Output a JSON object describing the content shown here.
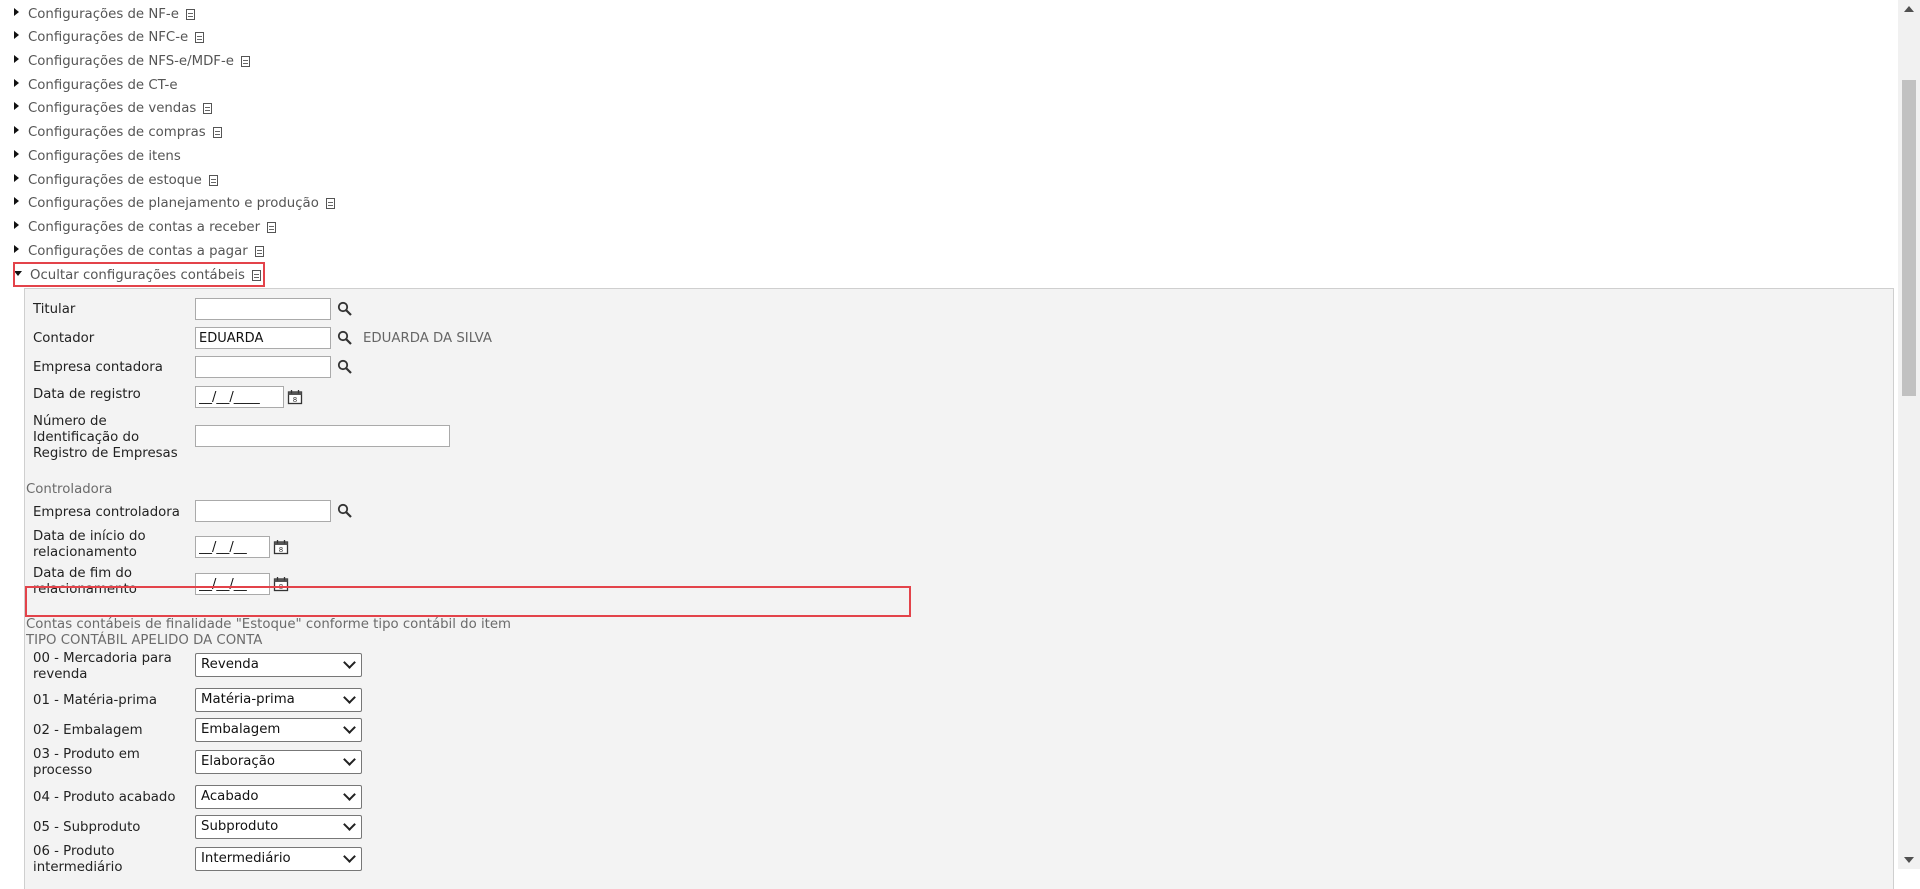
{
  "tree": {
    "items": [
      {
        "label": "Configurações de NF-e",
        "has_doc": true
      },
      {
        "label": "Configurações de NFC-e",
        "has_doc": true
      },
      {
        "label": "Configurações de NFS-e/MDF-e",
        "has_doc": true
      },
      {
        "label": "Configurações de CT-e",
        "has_doc": false
      },
      {
        "label": "Configurações de vendas",
        "has_doc": true
      },
      {
        "label": "Configurações de compras",
        "has_doc": true
      },
      {
        "label": "Configurações de itens",
        "has_doc": false
      },
      {
        "label": "Configurações de estoque",
        "has_doc": true
      },
      {
        "label": "Configurações de planejamento e produção",
        "has_doc": true
      },
      {
        "label": "Configurações de contas a receber",
        "has_doc": true
      },
      {
        "label": "Configurações de contas a pagar",
        "has_doc": true
      }
    ],
    "expanded_label": "Ocultar configurações contábeis"
  },
  "form": {
    "titular_label": "Titular",
    "titular_value": "",
    "contador_label": "Contador",
    "contador_value": "EDUARDA",
    "contador_lookup": "EDUARDA DA SILVA",
    "empresa_contadora_label": "Empresa contadora",
    "empresa_contadora_value": "",
    "data_registro_label": "Data de registro",
    "data_registro_value": "__/__/____",
    "nire_label_1": "Número de",
    "nire_label_2": "Identificação do",
    "nire_label_3": "Registro de Empresas",
    "nire_value": ""
  },
  "controladora": {
    "title": "Controladora",
    "empresa_label": "Empresa controladora",
    "empresa_value": "",
    "inicio_label_1": "Data de início do",
    "inicio_label_2": "relacionamento",
    "inicio_value": "__/__/__",
    "fim_label_1": "Data de fim do",
    "fim_label_2": "relacionamento",
    "fim_value": "__/__/__"
  },
  "estoque": {
    "title": "Contas contábeis de finalidade \"Estoque\" conforme tipo contábil do item",
    "header": "TIPO CONTÁBIL APELIDO DA CONTA",
    "rows": [
      {
        "label_1": "00 - Mercadoria para",
        "label_2": "revenda",
        "value": "Revenda"
      },
      {
        "label_1": "01 - Matéria-prima",
        "label_2": "",
        "value": "Matéria-prima"
      },
      {
        "label_1": "02 - Embalagem",
        "label_2": "",
        "value": "Embalagem"
      },
      {
        "label_1": "03 - Produto em",
        "label_2": "processo",
        "value": "Elaboração"
      },
      {
        "label_1": "04 - Produto acabado",
        "label_2": "",
        "value": "Acabado"
      },
      {
        "label_1": "05 - Subproduto",
        "label_2": "",
        "value": "Subproduto"
      },
      {
        "label_1": "06 - Produto",
        "label_2": "intermediário",
        "value": "Intermediário"
      }
    ]
  },
  "colors": {
    "highlight": "#e3434a",
    "panel_bg": "#f3f3f3",
    "label_gray": "#555555"
  }
}
